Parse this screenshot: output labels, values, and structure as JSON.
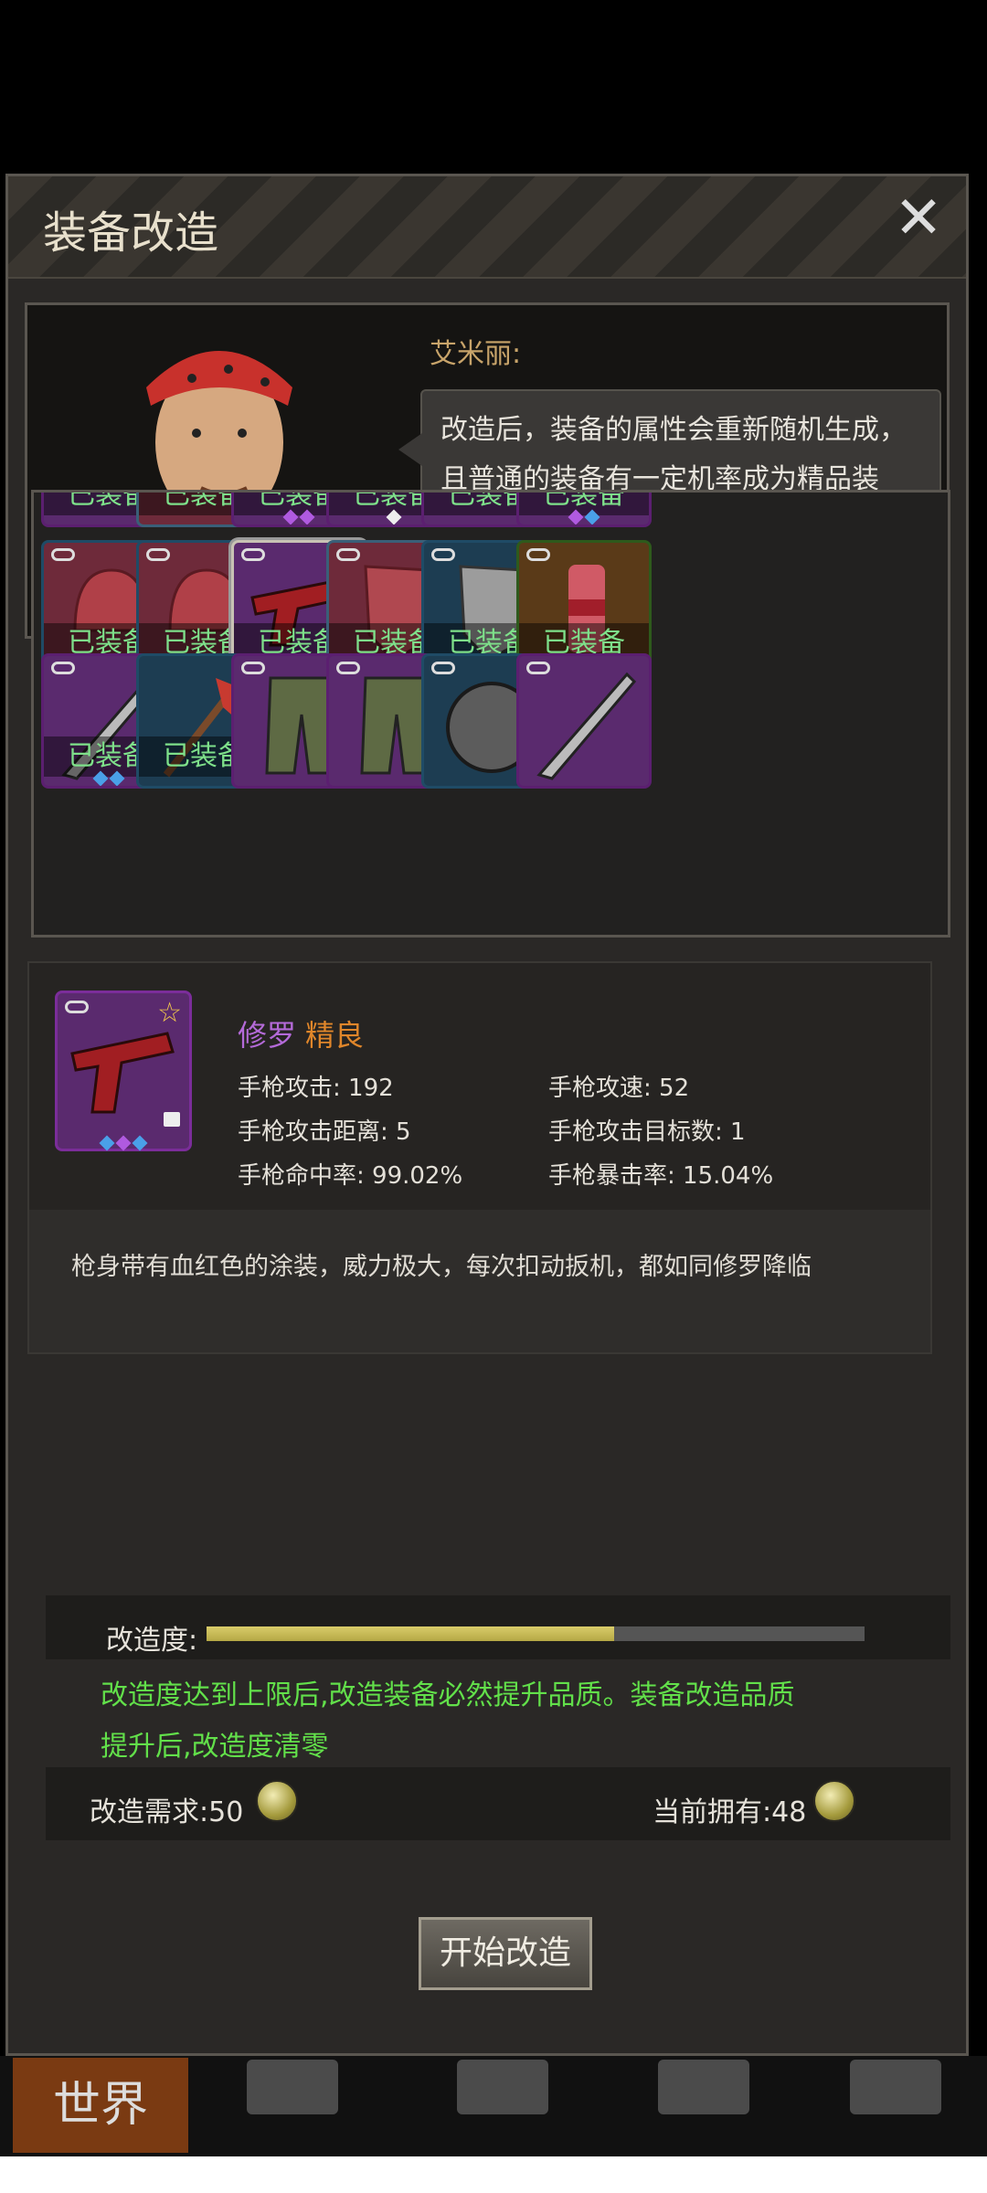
{
  "window": {
    "title": "装备改造",
    "close_label": "✕"
  },
  "npc": {
    "name": "艾米丽:",
    "speech": "改造后，装备的属性会重新随机生成，且普通的装备有一定机率成为精品装备，精品的装备有一定机率成为完美装备。"
  },
  "grid": {
    "equipped_label": "已装备",
    "rows": [
      [
        "已装备",
        "已装备",
        "已装备",
        "已装备",
        "已装备",
        "已装备"
      ],
      [
        "已装备",
        "已装备",
        "已装备",
        "已装备",
        "已装备",
        "已装备"
      ],
      [
        "已装备",
        "已装备",
        "",
        "",
        "",
        ""
      ]
    ]
  },
  "item": {
    "name": "修罗",
    "quality": "精良",
    "stats": {
      "attack": "手枪攻击: 192",
      "speed": "手枪攻速: 52",
      "range": "手枪攻击距离: 5",
      "targets": "手枪攻击目标数: 1",
      "hit": "手枪命中率: 99.02%",
      "crit": "手枪暴击率: 15.04%"
    },
    "description": "枪身带有血红色的涂装，威力极大，每次扣动扳机，都如同修罗降临"
  },
  "modify": {
    "progress_label": "改造度:",
    "progress_value": 0.62,
    "note": "改造度达到上限后,改造装备必然提升品质。装备改造品质提升后,改造度清零",
    "requirement": "改造需求:50",
    "owned": "当前拥有:48",
    "start_button": "开始改造"
  },
  "nav": {
    "world": "世界"
  },
  "colors": {
    "accent_green": "#62e04a",
    "equipped_green": "#7ee08a",
    "quality_orange": "#e0862a",
    "name_purple": "#b46ad8"
  }
}
